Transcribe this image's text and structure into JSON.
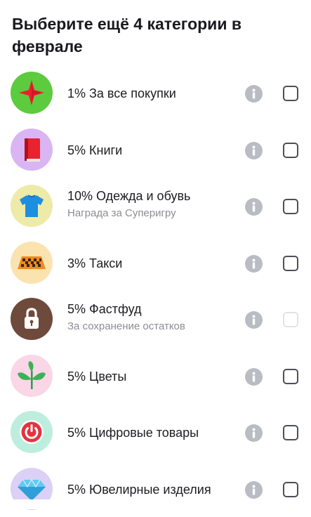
{
  "header": {
    "title": "Выберите ещё 4 категории в феврале"
  },
  "categories": [
    {
      "label": "1% За все покупки",
      "subtitle": "",
      "icon": "red-star-icon",
      "icon_bg": "#5ccb3e",
      "checked": false,
      "disabled": false
    },
    {
      "label": "5% Книги",
      "subtitle": "",
      "icon": "red-book-icon",
      "icon_bg": "#d9b6f3",
      "checked": false,
      "disabled": false
    },
    {
      "label": "10% Одежда и обувь",
      "subtitle": "Награда за Суперигру",
      "icon": "blue-tshirt-icon",
      "icon_bg": "#eeeaa8",
      "checked": false,
      "disabled": false
    },
    {
      "label": "3% Такси",
      "subtitle": "",
      "icon": "taxi-sign-icon",
      "icon_bg": "#fbe3b0",
      "checked": false,
      "disabled": false
    },
    {
      "label": "5% Фастфуд",
      "subtitle": "За сохранение остатков",
      "icon": "lock-icon",
      "icon_bg": "#6e4a3c",
      "checked": false,
      "disabled": true
    },
    {
      "label": "5% Цветы",
      "subtitle": "",
      "icon": "plant-sprout-icon",
      "icon_bg": "#fad6e7",
      "checked": false,
      "disabled": false
    },
    {
      "label": "5% Цифровые товары",
      "subtitle": "",
      "icon": "power-button-icon",
      "icon_bg": "#bdeedd",
      "checked": false,
      "disabled": false
    },
    {
      "label": "5% Ювелирные изделия",
      "subtitle": "",
      "icon": "diamond-icon",
      "icon_bg": "#dcd0f7",
      "checked": false,
      "disabled": false
    }
  ]
}
